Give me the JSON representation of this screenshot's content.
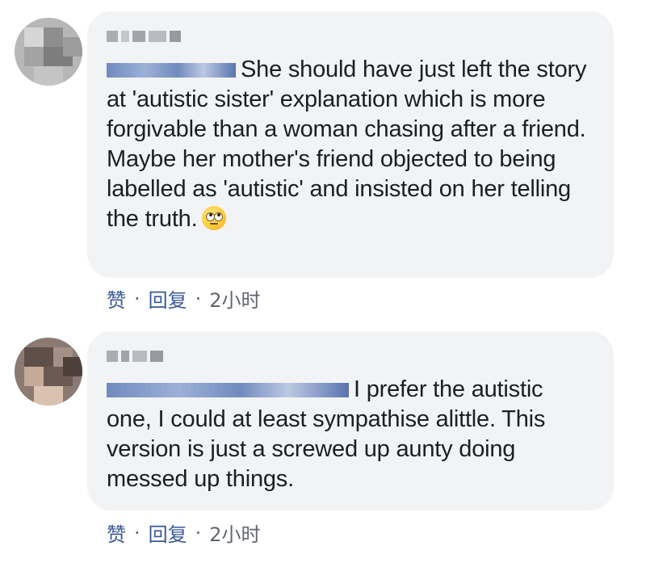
{
  "comments": [
    {
      "text": "She should have just left the story at 'autistic sister' explanation which is more forgivable than a woman chasing after a friend. Maybe her mother's friend objected to being labelled as 'autistic' and insisted on her telling the truth.",
      "emoji": "eye-roll-emoji",
      "actions": {
        "like": "赞",
        "separator1": "·",
        "reply": "回复",
        "separator2": "·",
        "time": "2小时"
      }
    },
    {
      "text": "I prefer the autistic one, I could at least sympathise alittle. This version is just a screwed up aunty doing messed up things.",
      "actions": {
        "like": "赞",
        "separator1": "·",
        "reply": "回复",
        "separator2": "·",
        "time": "2小时"
      }
    }
  ]
}
